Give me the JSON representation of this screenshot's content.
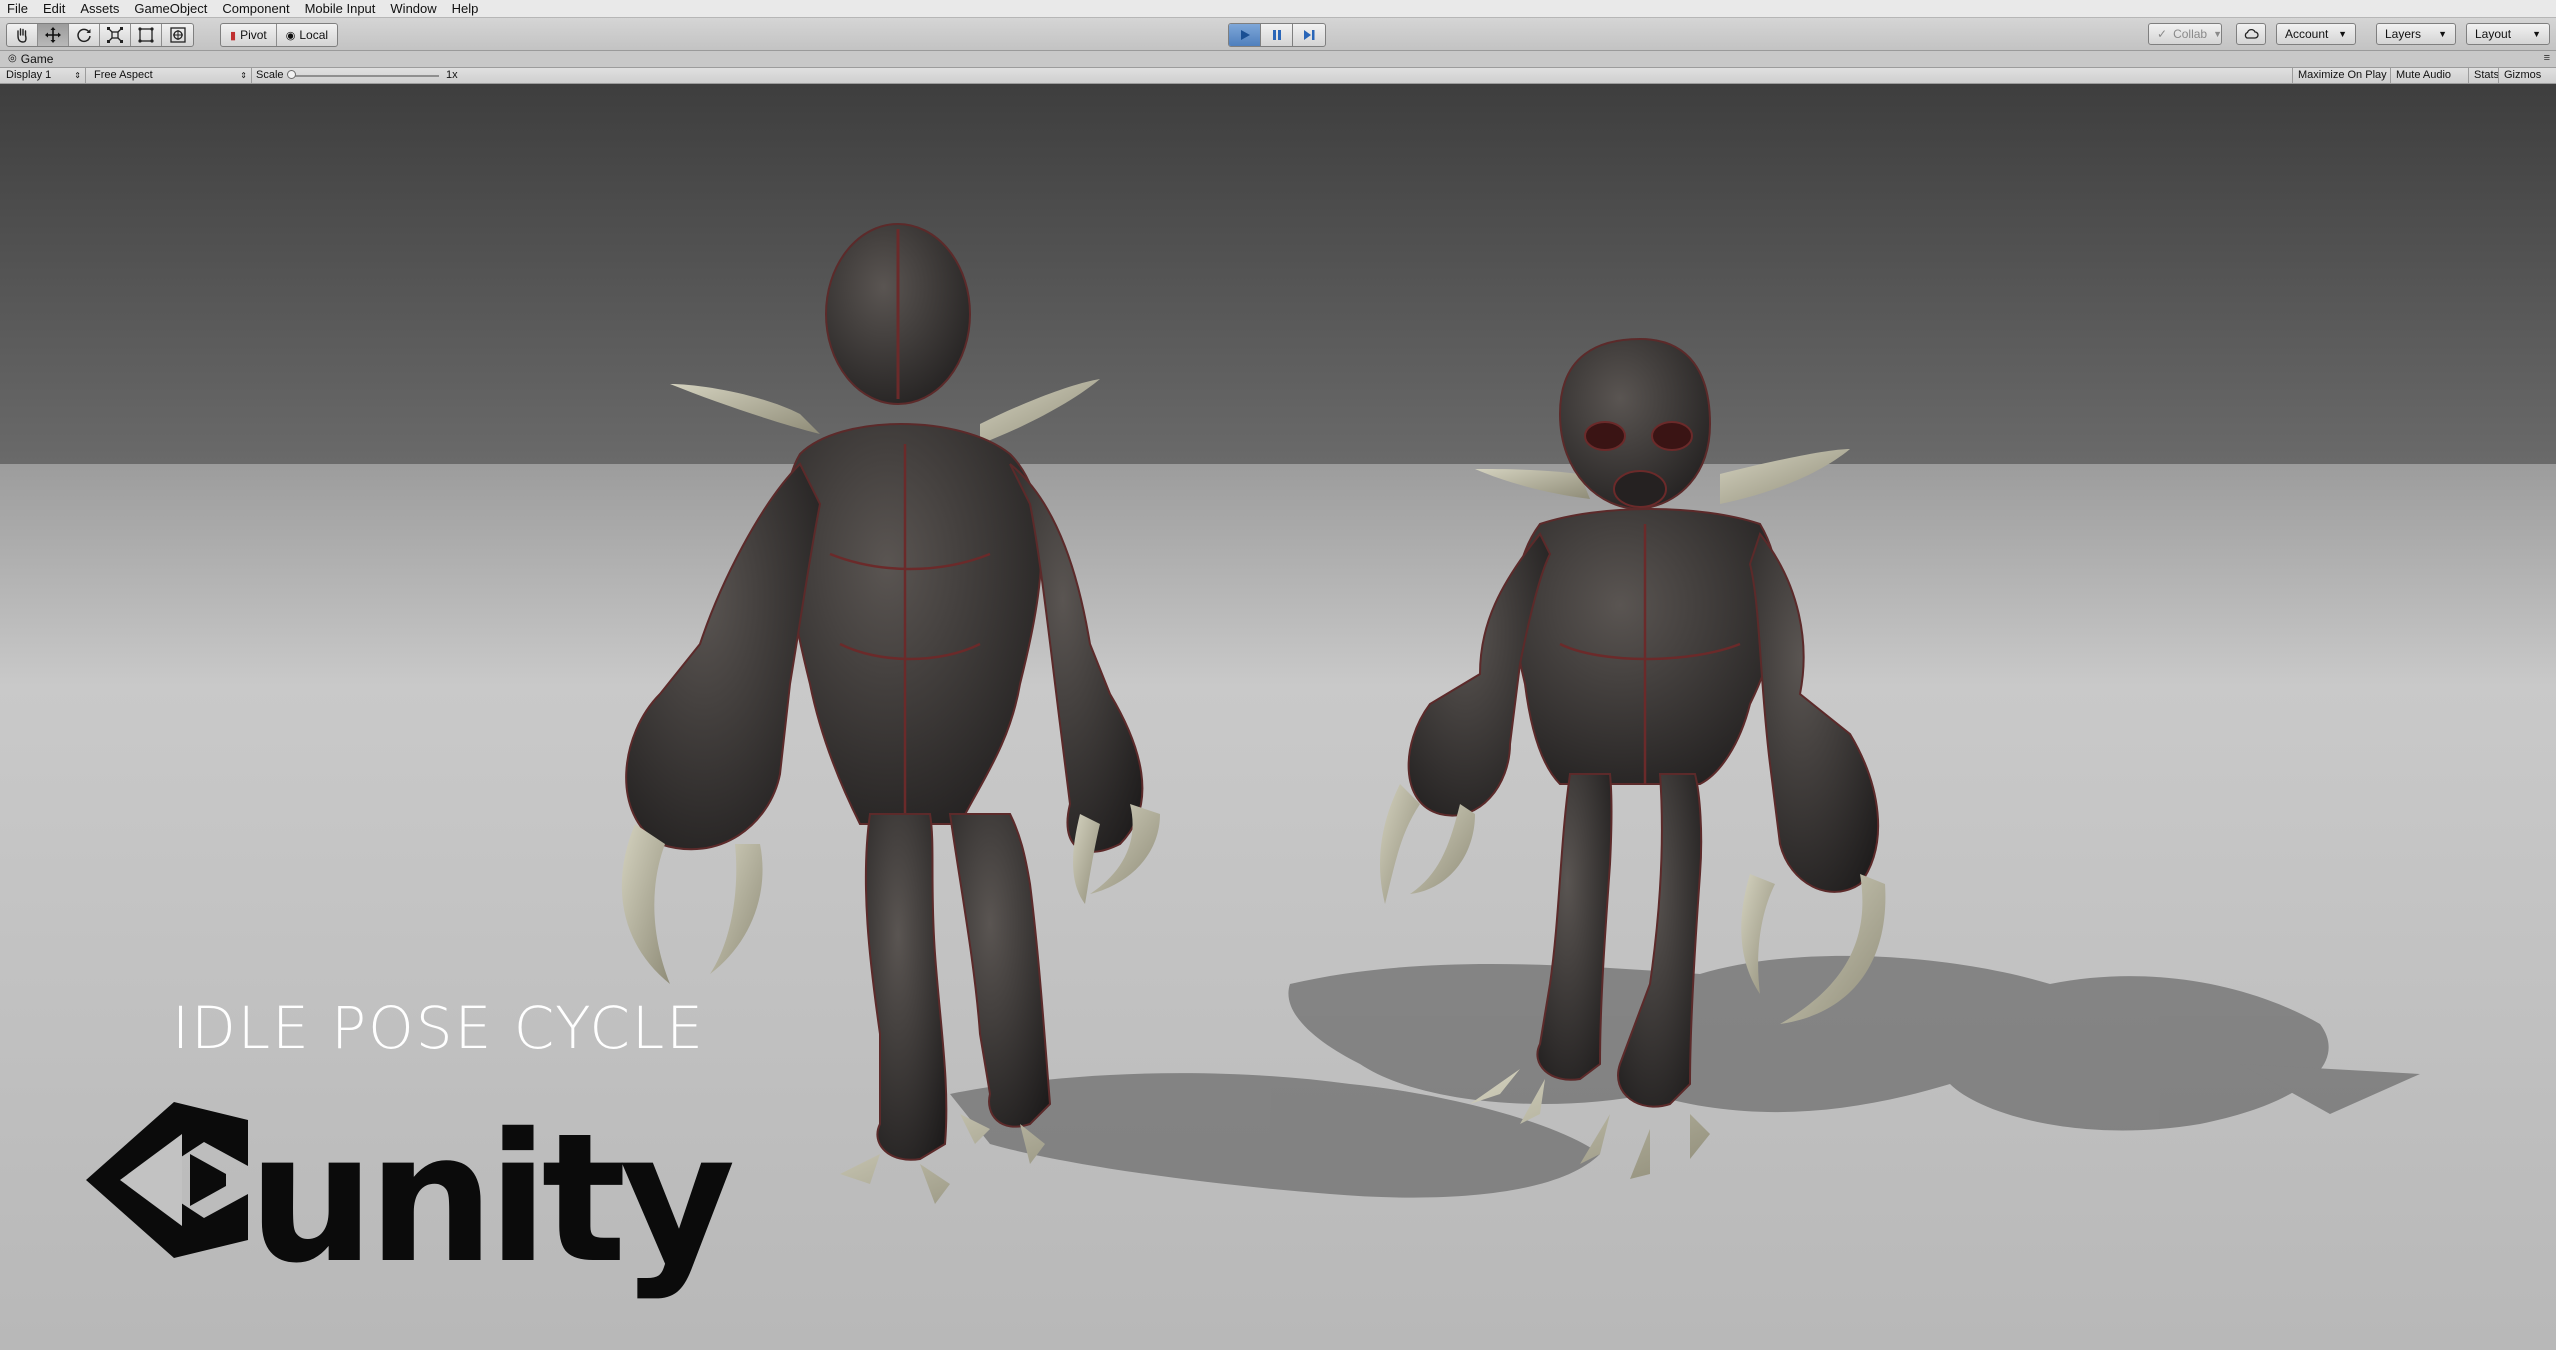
{
  "menubar": {
    "items": [
      "File",
      "Edit",
      "Assets",
      "GameObject",
      "Component",
      "Mobile Input",
      "Window",
      "Help"
    ]
  },
  "toolbar": {
    "tools": [
      {
        "name": "hand-tool",
        "icon": "hand-icon"
      },
      {
        "name": "move-tool",
        "icon": "move-icon"
      },
      {
        "name": "rotate-tool",
        "icon": "rotate-icon"
      },
      {
        "name": "scale-tool",
        "icon": "scale-icon"
      },
      {
        "name": "rect-tool",
        "icon": "rect-icon"
      },
      {
        "name": "transform-tool",
        "icon": "transform-icon"
      }
    ],
    "pivot_label": "Pivot",
    "local_label": "Local",
    "play_active": true,
    "collab_label": "Collab",
    "account_label": "Account",
    "layers_label": "Layers",
    "layout_label": "Layout",
    "accent_color": "#4f7fbd"
  },
  "game_tab": {
    "label": "Game"
  },
  "game_toolbar": {
    "display": "Display 1",
    "aspect": "Free Aspect",
    "scale_label": "Scale",
    "scale_value": "1x",
    "maximize_on_play": "Maximize On Play",
    "mute_audio": "Mute Audio",
    "stats": "Stats",
    "gizmos": "Gizmos"
  },
  "viewport": {
    "caption": "IDLE POSE CYCLE",
    "logo_text": "unity"
  }
}
